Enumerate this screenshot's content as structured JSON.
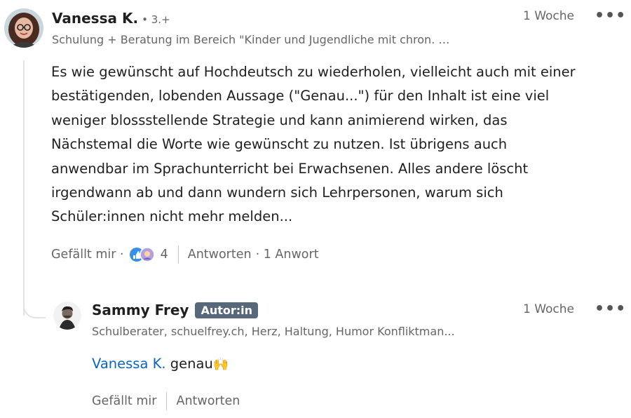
{
  "comment": {
    "author": "Vanessa K.",
    "degree": "• 3.+",
    "headline": "Schulung + Beratung im Bereich \"Kinder und Jugendliche mit chron. …",
    "time": "1 Woche",
    "more": "•••",
    "lines": [
      "Es wie gewünscht auf Hochdeutsch zu wiederholen, vielleicht auch mit einer",
      "bestätigenden, lobenden Aussage (\"Genau...\") für den Inhalt ist eine viel",
      "weniger blossstellende Strategie und kann animierend wirken, das",
      "Nächstemal die Worte wie gewünscht zu nutzen. Ist übrigens auch",
      "anwendbar im Sprachunterricht bei Erwachsenen. Alles andere löscht",
      "irgendwann ab und dann wundern sich Lehrpersonen, warum sich",
      "Schüler:innen nicht mehr melden..."
    ],
    "like_label": "Gefällt mir ·",
    "reaction_count": "4",
    "reply_label": "Antworten",
    "reply_count": "· 1 Anwort"
  },
  "reply": {
    "author": "Sammy Frey",
    "badge": "Autor:in",
    "headline": "Schulberater, schuelfrey.ch, Herz, Haltung, Humor Konfliktman...",
    "time": "1 Woche",
    "more": "•••",
    "mention": "Vanessa K.",
    "text": " genau",
    "emoji": "🙌",
    "like_label": "Gefällt mir",
    "reply_label": "Antworten"
  },
  "colors": {
    "link": "#0a66c2",
    "muted": "#666666",
    "badge": "#56687a"
  }
}
